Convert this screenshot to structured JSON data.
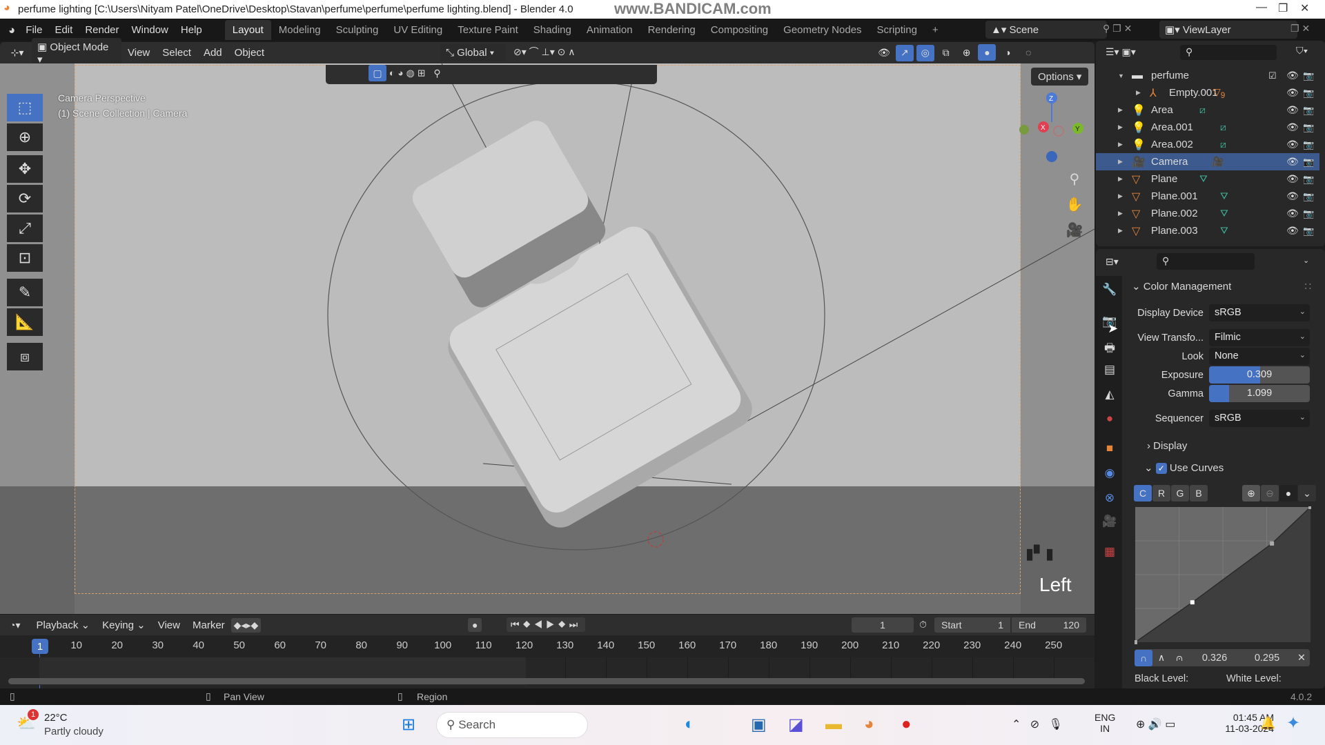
{
  "window": {
    "title": "perfume lighting [C:\\Users\\Nityam Patel\\OneDrive\\Desktop\\Stavan\\perfume\\perfume\\perfume lighting.blend] - Blender 4.0",
    "watermark": "www.BANDICAM.com"
  },
  "menu": [
    "File",
    "Edit",
    "Render",
    "Window",
    "Help"
  ],
  "workspaces": [
    "Layout",
    "Modeling",
    "Sculpting",
    "UV Editing",
    "Texture Paint",
    "Shading",
    "Animation",
    "Rendering",
    "Compositing",
    "Geometry Nodes",
    "Scripting"
  ],
  "active_workspace": "Layout",
  "scene": "Scene",
  "view_layer": "ViewLayer",
  "viewport_header": {
    "mode": "Object Mode",
    "menus": [
      "View",
      "Select",
      "Add",
      "Object"
    ],
    "orientation": "Global",
    "options": "Options"
  },
  "viewport": {
    "overlay_line1": "Camera Perspective",
    "overlay_line2": "(1) Scene Collection | Camera",
    "view_name": "Left",
    "accent": "#4672c4"
  },
  "outliner": {
    "items": [
      {
        "name": "perfume",
        "type": "collection"
      },
      {
        "name": "Empty.001",
        "type": "empty",
        "badge": "9"
      },
      {
        "name": "Area",
        "type": "light"
      },
      {
        "name": "Area.001",
        "type": "light"
      },
      {
        "name": "Area.002",
        "type": "light"
      },
      {
        "name": "Camera",
        "type": "camera",
        "selected": true
      },
      {
        "name": "Plane",
        "type": "mesh"
      },
      {
        "name": "Plane.001",
        "type": "mesh"
      },
      {
        "name": "Plane.002",
        "type": "mesh"
      },
      {
        "name": "Plane.003",
        "type": "mesh"
      }
    ]
  },
  "properties": {
    "panel": "Color Management",
    "display_device": {
      "label": "Display Device",
      "value": "sRGB"
    },
    "view_transform": {
      "label": "View Transfo...",
      "value": "Filmic"
    },
    "look": {
      "label": "Look",
      "value": "None"
    },
    "exposure": {
      "label": "Exposure",
      "value": "0.309",
      "fill_percent": 51
    },
    "gamma": {
      "label": "Gamma",
      "value": "1.099",
      "fill_percent": 20
    },
    "sequencer": {
      "label": "Sequencer",
      "value": "sRGB"
    },
    "display": "Display",
    "use_curves": {
      "label": "Use Curves",
      "checked": true
    },
    "channels": [
      "C",
      "R",
      "G",
      "B"
    ],
    "curve_points": [
      [
        0,
        0
      ],
      [
        0.326,
        0.295
      ],
      [
        0.78,
        0.73
      ],
      [
        1,
        1
      ]
    ],
    "selected_x": "0.326",
    "selected_y": "0.295",
    "black_level": "Black Level:",
    "white_level": "White Level:"
  },
  "timeline": {
    "menus": [
      "Playback",
      "Keying",
      "View",
      "Marker"
    ],
    "current_frame": "1",
    "start_label": "Start",
    "start": "1",
    "end_label": "End",
    "end": "120",
    "ticks": [
      "10",
      "20",
      "30",
      "40",
      "50",
      "60",
      "70",
      "80",
      "90",
      "100",
      "110",
      "120",
      "130",
      "140",
      "150",
      "160",
      "170",
      "180",
      "190",
      "200",
      "210",
      "220",
      "230",
      "240",
      "250"
    ]
  },
  "statusbar": {
    "pan": "Pan View",
    "region": "Region",
    "version": "4.0.2"
  },
  "taskbar": {
    "temp": "22°C",
    "weather": "Partly cloudy",
    "weather_badge": "1",
    "search": "Search",
    "lang1": "ENG",
    "lang2": "IN",
    "time": "01:45 AM",
    "date": "11-03-2024"
  }
}
